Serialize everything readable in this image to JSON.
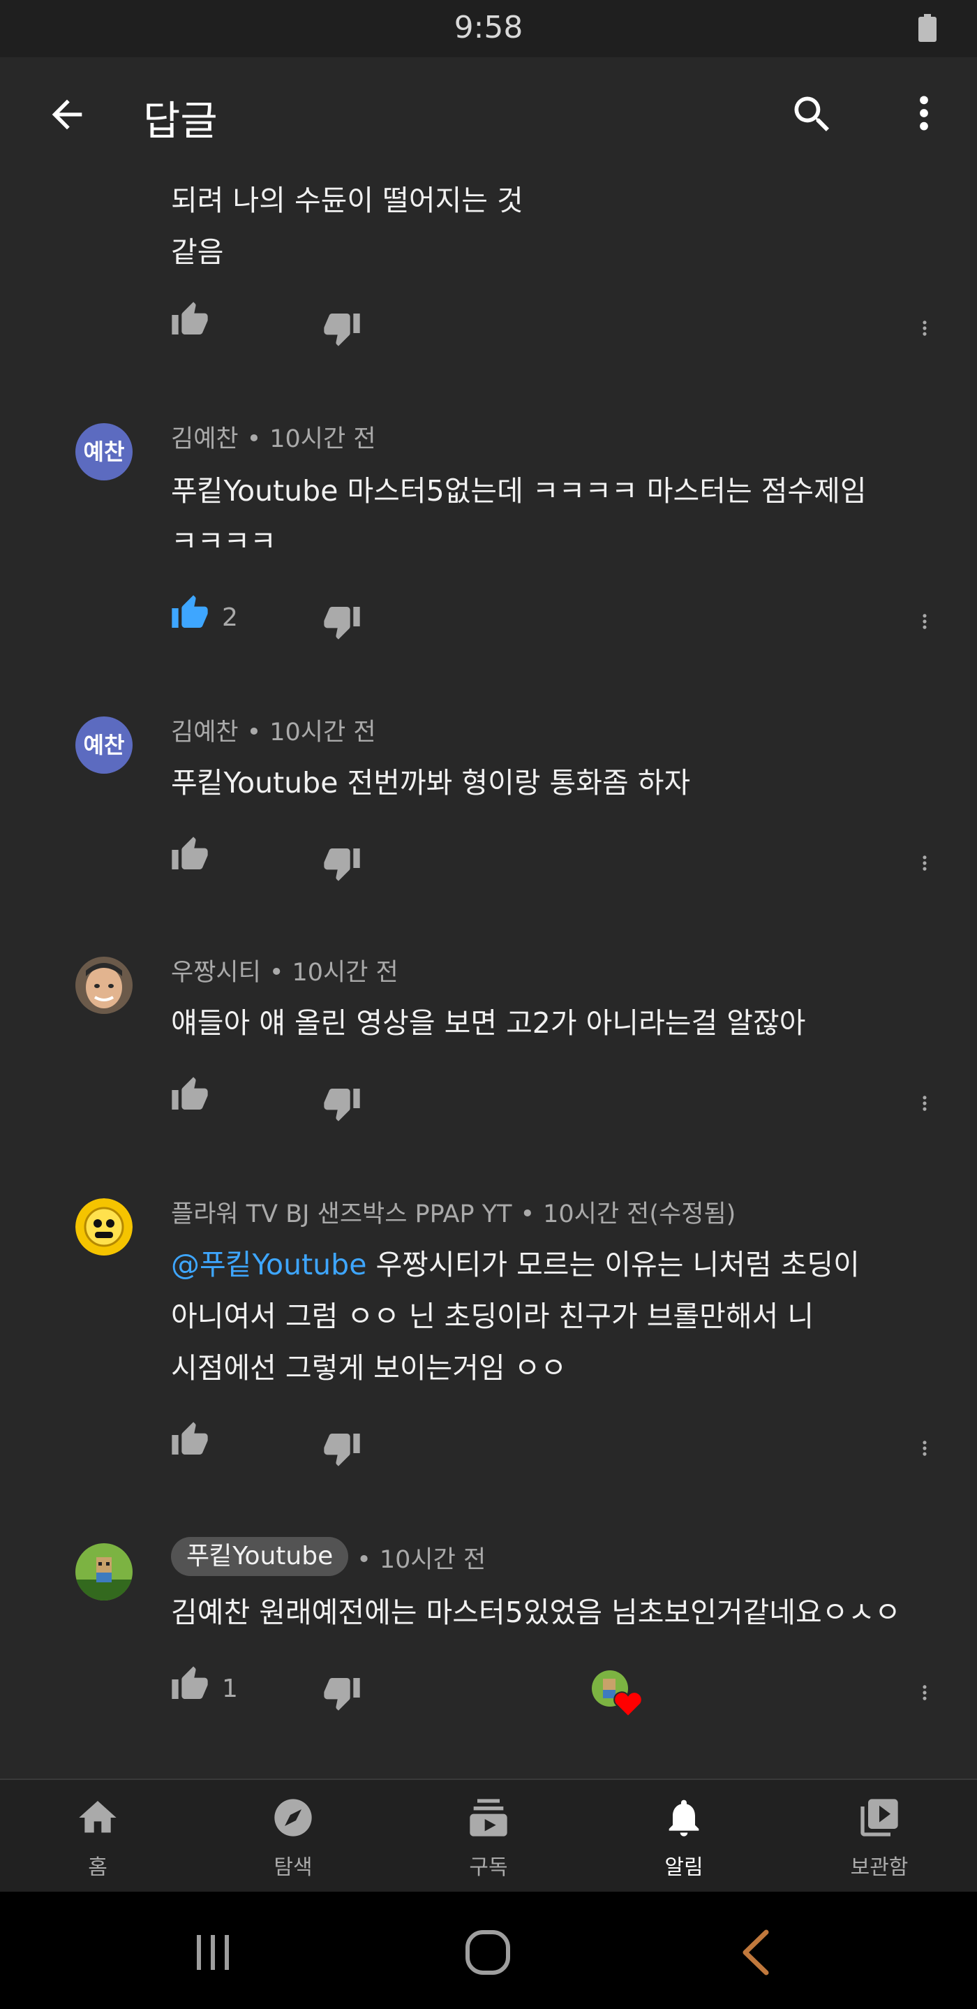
{
  "status_bar": {
    "time": "9:58"
  },
  "app_bar": {
    "title": "답글",
    "back_icon": "arrow-back-icon",
    "search_icon": "search-icon",
    "more_icon": "more-vert-icon"
  },
  "comments": [
    {
      "lines": [
        "되려 나의 수듄이 떨어지는 것",
        "같음"
      ]
    },
    {
      "author": "김예찬",
      "time": "10시간 전",
      "avatar_text": "예찬",
      "lines": [
        "푸킽Youtube 마스터5없는데 ㅋㅋㅋㅋ 마스터는 점수제임",
        "ㅋㅋㅋㅋ"
      ],
      "likes": "2"
    },
    {
      "author": "김예찬",
      "time": "10시간 전",
      "avatar_text": "예찬",
      "lines": [
        "푸킽Youtube 전번까봐 형이랑 통화좀 하자"
      ]
    },
    {
      "author": "우짱시티",
      "time": "10시간 전",
      "lines": [
        "얘들아 얘 올린 영상을 보면 고2가 아니라는걸 알잖아"
      ]
    },
    {
      "author": "플라워 TV BJ 샌즈박스 PPAP YT",
      "time": "10시간 전(수정됨)",
      "mention": "@푸킽Youtube",
      "lines": [
        " 우짱시티가 모르는 이유는 니처럼 초딩이",
        "아니여서 그럼 ㅇㅇ 닌 초딩이라 친구가 브롤만해서 니",
        "시점에선 그렇게 보이는거임 ㅇㅇ"
      ]
    },
    {
      "author": "푸킽Youtube",
      "time": "10시간 전",
      "lines": [
        "김예찬 원래예전에는 마스터5있었음 님초보인거같네요ㅇㅅㅇ"
      ],
      "likes": "1",
      "creator_heart": true
    }
  ],
  "bottom_nav": [
    {
      "label": "홈",
      "icon": "home-icon"
    },
    {
      "label": "탐색",
      "icon": "explore-icon"
    },
    {
      "label": "구독",
      "icon": "subscriptions-icon"
    },
    {
      "label": "알림",
      "icon": "notifications-icon",
      "active": true
    },
    {
      "label": "보관함",
      "icon": "library-icon"
    }
  ],
  "system_nav": {
    "recents_icon": "recents-icon",
    "home_icon": "home-circle-icon",
    "back_icon": "back-chevron-icon"
  },
  "colors": {
    "background": "#282828",
    "accent_like": "#3ea6ff",
    "mention": "#3ea6ff",
    "avatar_initials_bg": "#5c6bc0",
    "heart": "#ff0000"
  }
}
